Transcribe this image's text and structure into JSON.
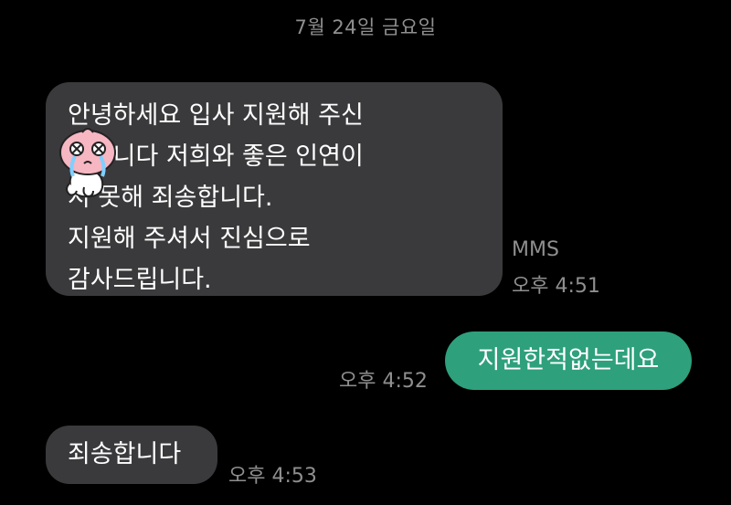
{
  "conversation": {
    "date": "7월 24일 금요일",
    "messages": [
      {
        "direction": "incoming",
        "lines": [
          "안녕하세요 입사 지원해 주신",
          "   드입니다 저희와 좋은 인연이",
          "   지 못해 죄송합니다.",
          "지원해 주셔서 진심으로",
          "감사드립니다."
        ],
        "type_label": "MMS",
        "time": "오후 4:51"
      },
      {
        "direction": "outgoing",
        "text": "지원한적없는데요",
        "time": "오후 4:52"
      },
      {
        "direction": "incoming",
        "text": "죄송합니다",
        "time": "오후 4:53"
      }
    ]
  },
  "colors": {
    "background": "#000000",
    "incoming_bubble": "#3a3a3c",
    "outgoing_bubble": "#2ea07c",
    "meta_text": "#8f8f8f"
  },
  "overlay": {
    "icon": "crying-peach-sticker-icon"
  }
}
